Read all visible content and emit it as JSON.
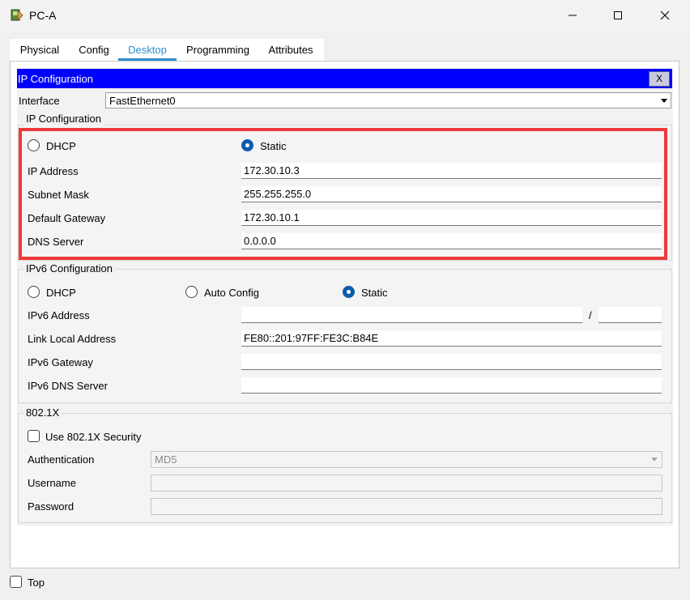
{
  "window": {
    "title": "PC-A",
    "controls": {
      "minimize": "minimize-icon",
      "maximize": "maximize-icon",
      "close": "close-icon"
    }
  },
  "tabs": [
    "Physical",
    "Config",
    "Desktop",
    "Programming",
    "Attributes"
  ],
  "active_tab": "Desktop",
  "app": {
    "title": "IP Configuration",
    "close_label": "X",
    "interface_label": "Interface",
    "interface_value": "FastEthernet0"
  },
  "ipv4": {
    "group_title": "IP Configuration",
    "dhcp_label": "DHCP",
    "static_label": "Static",
    "mode": "Static",
    "ip_label": "IP Address",
    "ip_value": "172.30.10.3",
    "mask_label": "Subnet Mask",
    "mask_value": "255.255.255.0",
    "gateway_label": "Default Gateway",
    "gateway_value": "172.30.10.1",
    "dns_label": "DNS Server",
    "dns_value": "0.0.0.0"
  },
  "ipv6": {
    "group_title": "IPv6 Configuration",
    "dhcp_label": "DHCP",
    "auto_label": "Auto Config",
    "static_label": "Static",
    "mode": "Static",
    "address_label": "IPv6 Address",
    "address_value": "",
    "prefix_separator": "/",
    "prefix_value": "",
    "link_local_label": "Link Local Address",
    "link_local_value": "FE80::201:97FF:FE3C:B84E",
    "gateway_label": "IPv6 Gateway",
    "gateway_value": "",
    "dns_label": "IPv6 DNS Server",
    "dns_value": ""
  },
  "dot1x": {
    "group_title": "802.1X",
    "use_label": "Use 802.1X Security",
    "use_checked": false,
    "auth_label": "Authentication",
    "auth_value": "MD5",
    "username_label": "Username",
    "username_value": "",
    "password_label": "Password",
    "password_value": ""
  },
  "footer": {
    "top_label": "Top",
    "top_checked": false
  },
  "colors": {
    "app_header": "#0000ff",
    "active_tab": "#2e8fd0",
    "radio_selected": "#0b5cad",
    "highlight_box": "#ee3a3a"
  }
}
